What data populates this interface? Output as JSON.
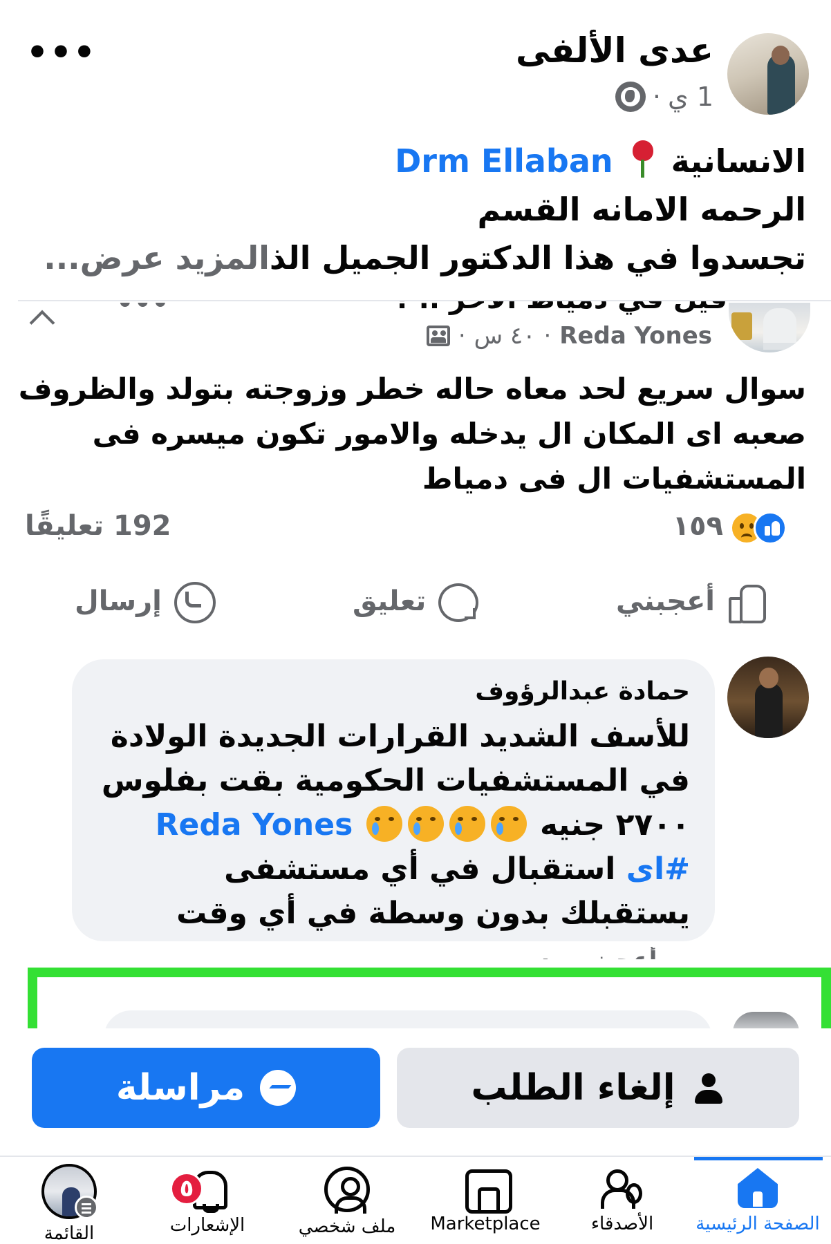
{
  "post": {
    "author": "عدى الألفى",
    "time": "1 ي",
    "separator": "·",
    "more": "•••",
    "caption": {
      "line1_text": "الانسانية",
      "line1_mention": "Drm Ellaban",
      "line2": "الرحمه الامانه القسم",
      "line3_text": "تجسدوا في هذا الدكتور الجميل الذ",
      "see_more": "المزيد عرض..."
    }
  },
  "shared_post": {
    "cut_title": "قيل في دمياط الآخر .. ؟",
    "more": "•••",
    "author": "Reda Yones",
    "time": "٤٠ س",
    "text": "سوال سريع لحد معاه حاله خطر وزوجته بتولد والظروف صعبه اى المكان ال يدخله والامور تكون ميسره فى المستشفيات ال فى دمياط"
  },
  "stats": {
    "reactions": "١٥٩",
    "comments": "192 تعليقًا"
  },
  "actions": {
    "like": "أعجبني",
    "comment": "تعليق",
    "send": "إرسال"
  },
  "comment": {
    "author": "حمادة عبدالرؤوف",
    "line1": "للأسف الشديد القرارات الجديدة الولادة في المستشفيات الحكومية بقت بفلوس ٢٧٠٠ جنيه",
    "mention": "Reda Yones",
    "hashtag": "#اى",
    "line2": "استقبال في أي مستشفى يستقبلك بدون وسطة في أي وقت",
    "reply_peek": "أعجبني رد"
  },
  "profile_buttons": {
    "cancel": "إلغاء الطلب",
    "message": "مراسلة"
  },
  "bottom_nav": {
    "home": "الصفحة الرئيسية",
    "friends": "الأصدقاء",
    "marketplace": "Marketplace",
    "profile": "ملف شخصي",
    "notifications": "الإشعارات",
    "notifications_count": "٥",
    "menu": "القائمة"
  },
  "colors": {
    "accent": "#1877f2",
    "highlight": "#34e034",
    "badge": "#e41e3f"
  }
}
